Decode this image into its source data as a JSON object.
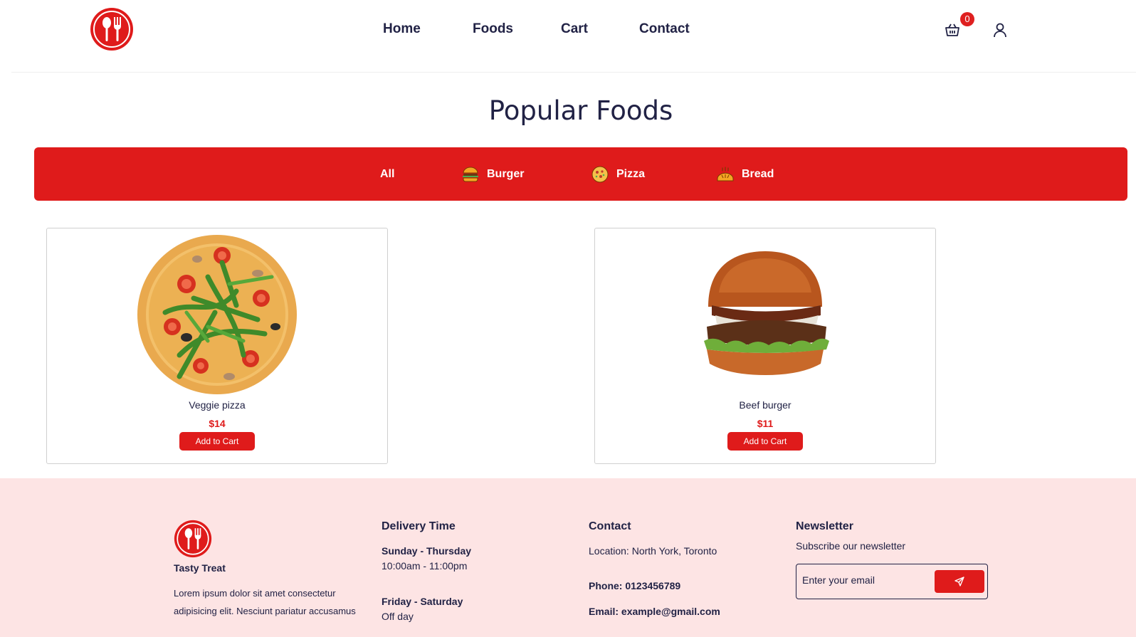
{
  "nav": {
    "links": [
      "Home",
      "Foods",
      "Cart",
      "Contact"
    ],
    "cart_count": "0"
  },
  "section": {
    "title": "Popular Foods"
  },
  "categories": [
    "All",
    "Burger",
    "Pizza",
    "Bread"
  ],
  "products": [
    {
      "name": "Veggie pizza",
      "price": "$14",
      "button": "Add to Cart"
    },
    {
      "name": "Beef burger",
      "price": "$11",
      "button": "Add to Cart"
    }
  ],
  "footer": {
    "brand": "Tasty Treat",
    "description_1": "Lorem ipsum dolor sit amet consectetur",
    "description_2": "adipisicing elit. Nesciunt pariatur accusamus",
    "delivery": {
      "heading": "Delivery Time",
      "day1": "Sunday - Thursday",
      "time1": "10:00am - 11:00pm",
      "day2": "Friday - Saturday",
      "time2": "Off day"
    },
    "contact": {
      "heading": "Contact",
      "location": "Location: North York, Toronto",
      "phone": "Phone: 0123456789",
      "email": "Email: example@gmail.com"
    },
    "newsletter": {
      "heading": "Newsletter",
      "subtitle": "Subscribe our newsletter",
      "placeholder": "Enter your email"
    }
  },
  "colors": {
    "accent": "#df1b1b",
    "footer_bg": "#fde4e4",
    "text": "#212245"
  },
  "icons": [
    "logo-spoon-fork-icon",
    "cart-basket-icon",
    "user-icon",
    "burger-icon",
    "pizza-icon",
    "bread-icon",
    "send-icon"
  ]
}
